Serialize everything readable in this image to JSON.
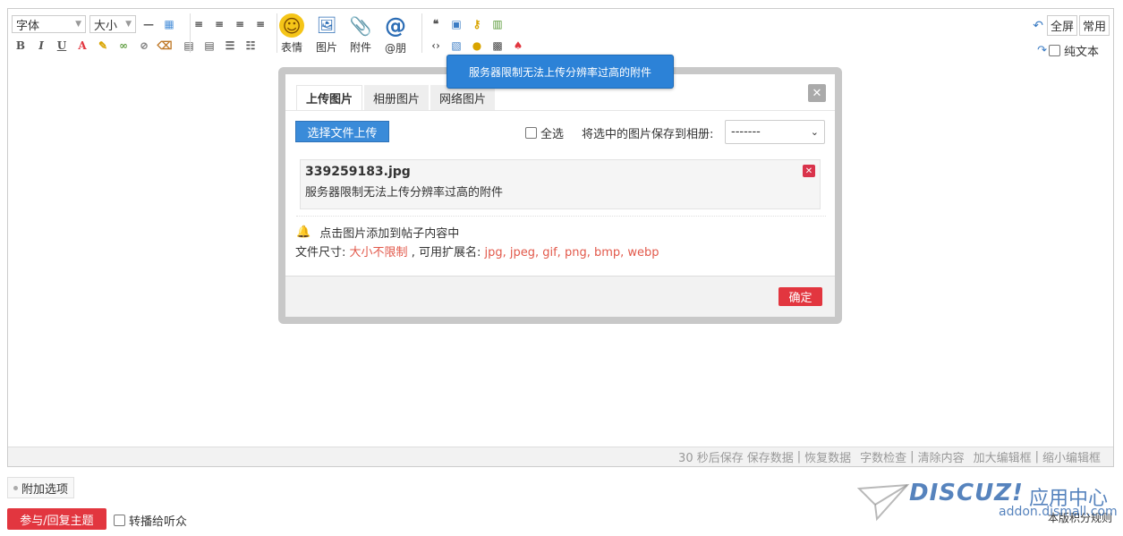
{
  "toolbar": {
    "font_label": "字体",
    "size_label": "大小",
    "emoji_label": "表情",
    "image_label": "图片",
    "attach_label": "附件",
    "at_label": "@朋",
    "fullscreen_label": "全屏",
    "common_label": "常用",
    "plain_text_label": "纯文本"
  },
  "tooltip": {
    "text": "服务器限制无法上传分辨率过高的附件"
  },
  "dialog": {
    "tabs": [
      {
        "label": "上传图片"
      },
      {
        "label": "相册图片"
      },
      {
        "label": "网络图片"
      }
    ],
    "upload_button": "选择文件上传",
    "select_all": "全选",
    "save_to_album": "将选中的图片保存到相册:",
    "album_value": "-------",
    "file": {
      "name": "339259183.jpg",
      "message": "服务器限制无法上传分辨率过高的附件"
    },
    "hint_click": "点击图片添加到帖子内容中",
    "size_label": "文件尺寸:",
    "size_value": "大小不限制",
    "ext_label": ", 可用扩展名:",
    "ext_value": "jpg, jpeg, gif, png, bmp, webp",
    "ok_button": "确定"
  },
  "statusbar": {
    "autosave": "30 秒后保存",
    "save_data": "保存数据",
    "restore_data": "恢复数据",
    "word_check": "字数检查",
    "clear_content": "清除内容",
    "enlarge": "加大编辑框",
    "shrink": "缩小编辑框"
  },
  "footer": {
    "extra_options": "附加选项",
    "reply_button": "参与/回复主题",
    "forward_label": "转播给听众",
    "rules_link": "本版积分规则"
  },
  "watermark": {
    "logo": "DISCUZ!",
    "cn": "应用中心",
    "url": "addon.dismall.com"
  },
  "colors": {
    "accent_blue": "#2c82d7",
    "danger_red": "#e2363f",
    "hint_red": "#e2584a"
  }
}
